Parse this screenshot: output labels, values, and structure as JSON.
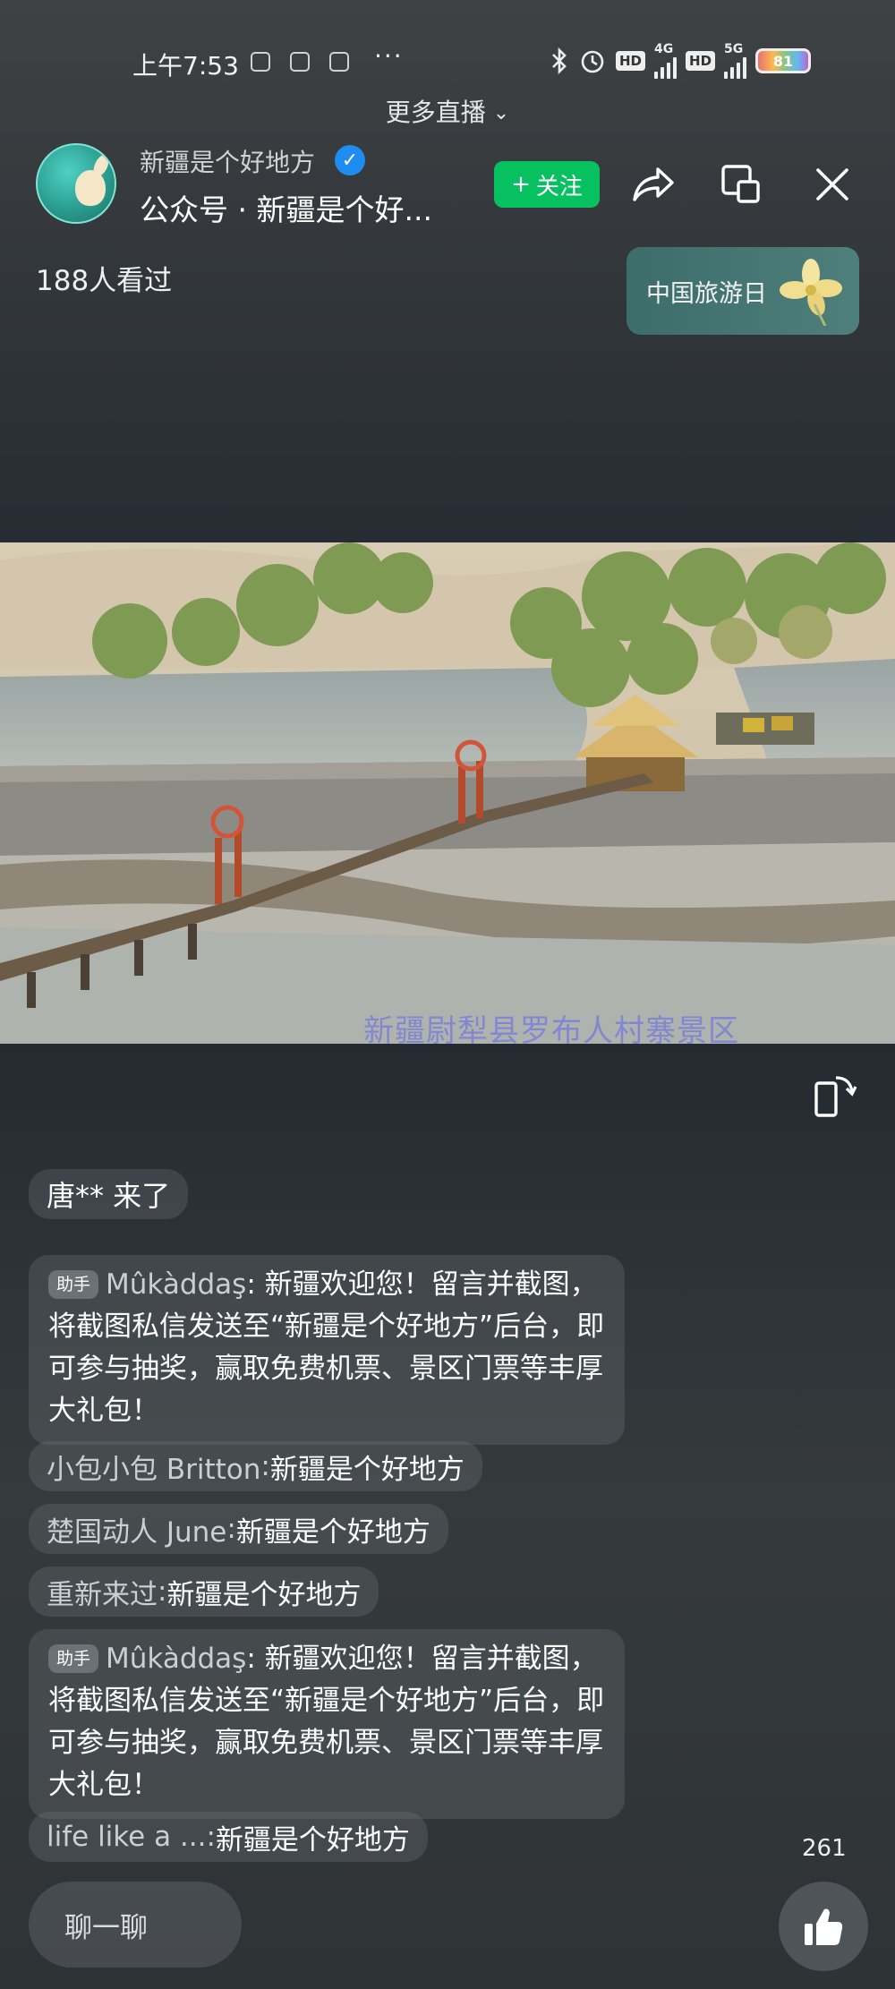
{
  "status_bar": {
    "time": "上午7:53",
    "dots": "···",
    "hd1": "HD",
    "net1": "4G",
    "hd2": "HD",
    "net2": "5G",
    "battery": "81"
  },
  "more_live": {
    "label": "更多直播"
  },
  "header": {
    "channel_name": "新疆是个好地方",
    "channel_sub": "公众号 · 新疆是个好...",
    "follow_label": "关注",
    "viewers": "188人看过"
  },
  "badge": {
    "label": "中国旅游日"
  },
  "video": {
    "watermark": "新疆尉犁县罗布人村寨景区"
  },
  "chat": {
    "join": "唐** 来了",
    "helper_tag": "助手",
    "messages": [
      {
        "user": "Mûkàddaş",
        "text": "新疆欢迎您！留言并截图，将截图私信发送至“新疆是个好地方”后台，即可参与抽奖，赢取免费机票、景区门票等丰厚大礼包！"
      },
      {
        "user": "小包小包 Britton",
        "text": "新疆是个好地方"
      },
      {
        "user": "楚国动人 June",
        "text": "新疆是个好地方"
      },
      {
        "user": "重新来过",
        "text": "新疆是个好地方"
      },
      {
        "user": "Mûkàddaş",
        "text": "新疆欢迎您！留言并截图，将截图私信发送至“新疆是个好地方”后台，即可参与抽奖，赢取免费机票、景区门票等丰厚大礼包！"
      },
      {
        "user": "life like a ...",
        "text": "新疆是个好地方"
      }
    ]
  },
  "footer": {
    "input_placeholder": "聊一聊",
    "likes": "261"
  },
  "colors": {
    "follow_green": "#07c160",
    "verified_blue": "#1f8cf0"
  }
}
